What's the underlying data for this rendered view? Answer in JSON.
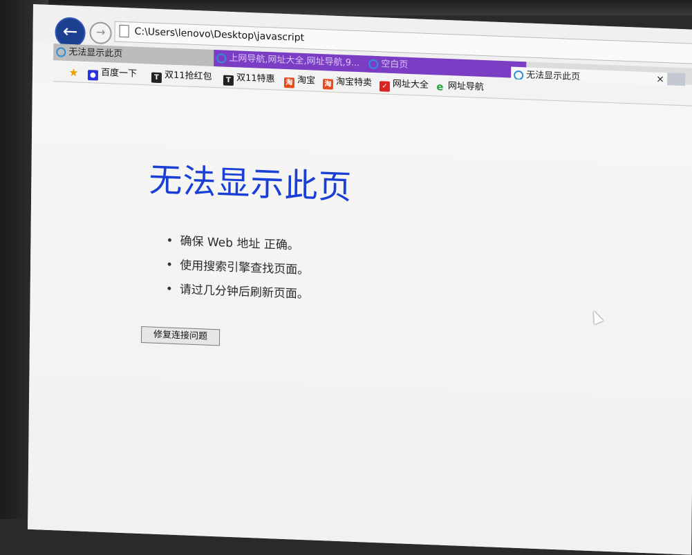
{
  "browser": {
    "url": "C:\\Users\\lenovo\\Desktop\\javascript",
    "tabs": [
      {
        "title": "无法显示此页"
      },
      {
        "title": "上网导航,网址大全,网址导航,9..."
      },
      {
        "title": "空白页"
      },
      {
        "title": "无法显示此页"
      }
    ],
    "close_glyph": "×",
    "favorites": [
      {
        "label": "",
        "icon": "favorites-star-icon"
      },
      {
        "label": "百度一下",
        "icon": "baidu-icon"
      },
      {
        "label": "双11抢红包",
        "icon": "tmall-icon"
      },
      {
        "label": "双11特惠",
        "icon": "tmall-icon"
      },
      {
        "label": "淘宝",
        "icon": "taobao-icon"
      },
      {
        "label": "淘宝特卖",
        "icon": "taobao-icon"
      },
      {
        "label": "网址大全",
        "icon": "hao123-icon"
      },
      {
        "label": "网址导航",
        "icon": "ie-icon"
      }
    ]
  },
  "error_page": {
    "title": "无法显示此页",
    "suggestions": [
      "确保 Web 地址 正确。",
      "使用搜索引擎查找页面。",
      "请过几分钟后刷新页面。"
    ],
    "fix_button_label": "修复连接问题"
  }
}
